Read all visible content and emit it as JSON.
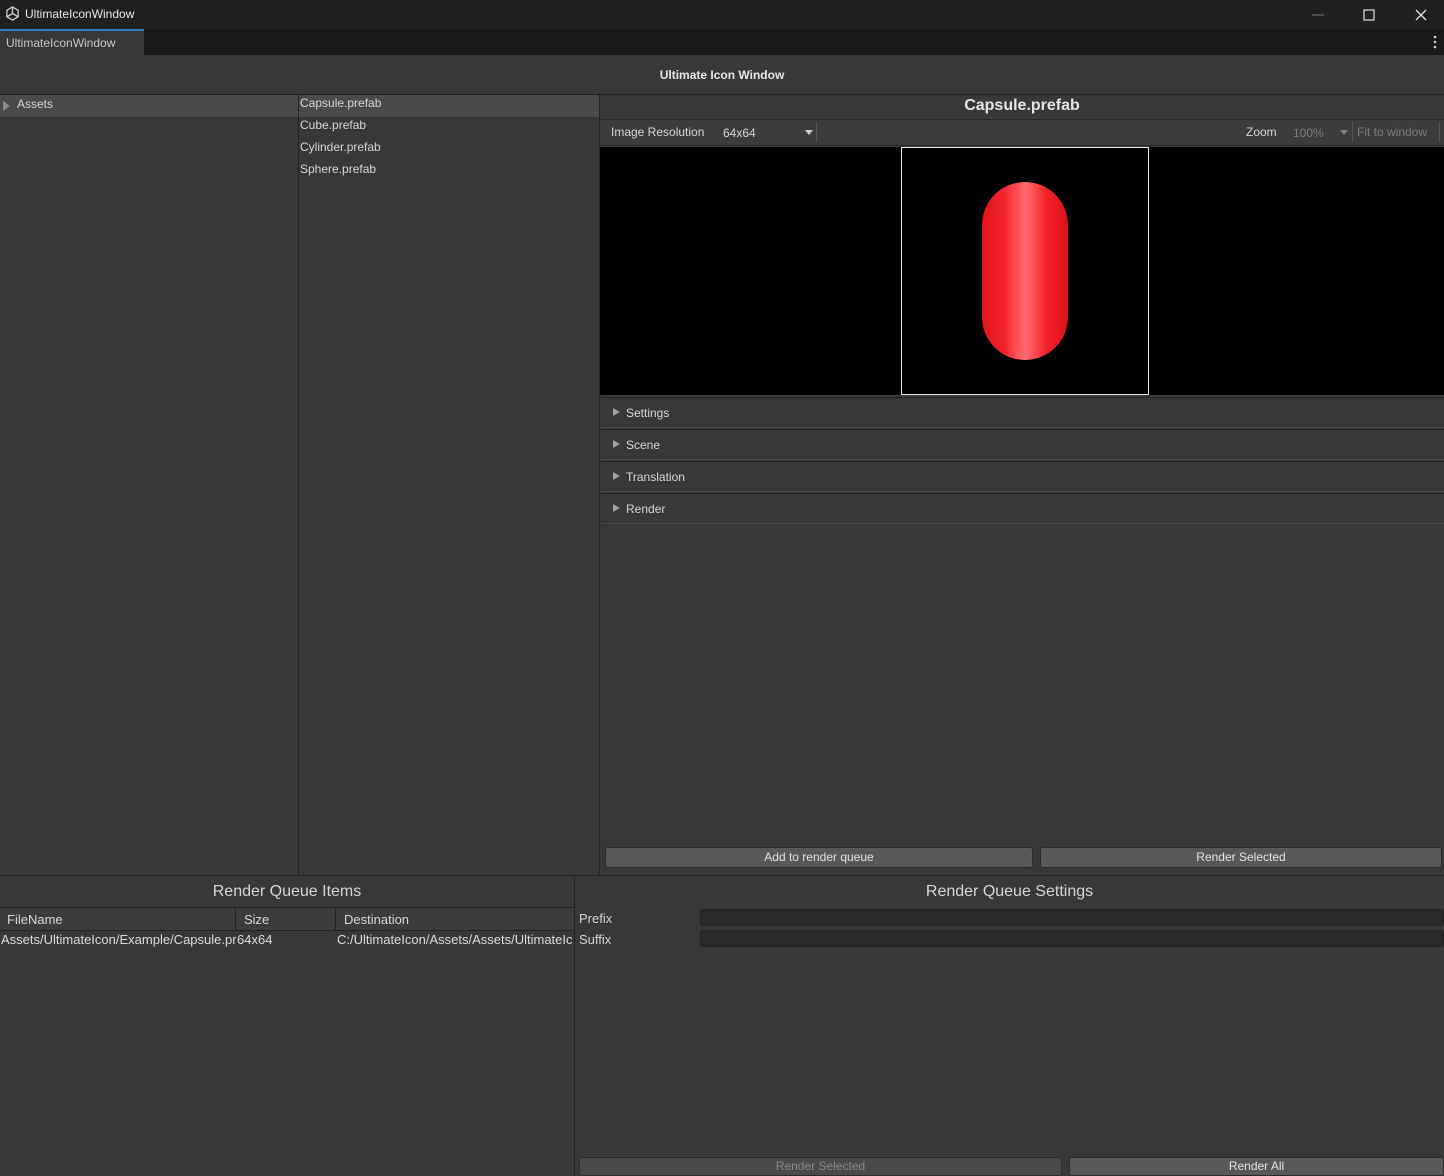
{
  "window": {
    "title": "UltimateIconWindow",
    "tab_label": "UltimateIconWindow",
    "heading": "Ultimate Icon Window"
  },
  "tree": {
    "root_label": "Assets"
  },
  "files": [
    {
      "name": "Capsule.prefab",
      "selected": true
    },
    {
      "name": "Cube.prefab",
      "selected": false
    },
    {
      "name": "Cylinder.prefab",
      "selected": false
    },
    {
      "name": "Sphere.prefab",
      "selected": false
    }
  ],
  "inspector": {
    "asset_title": "Capsule.prefab",
    "resolution_label": "Image Resolution",
    "resolution_value": "64x64",
    "zoom_label": "Zoom",
    "zoom_value": "100%",
    "fit_label": "Fit to window",
    "preview_color": "#f5222a",
    "foldouts": [
      "Settings",
      "Scene",
      "Translation",
      "Render"
    ],
    "add_queue_label": "Add to render queue",
    "render_selected_label": "Render Selected"
  },
  "queue": {
    "title": "Render Queue Items",
    "columns": [
      "FileName",
      "Size",
      "Destination"
    ],
    "rows": [
      {
        "filename": "Assets/UltimateIcon/Example/Capsule.prefab",
        "size": "64x64",
        "destination": "C:/UltimateIcon/Assets/Assets/UltimateIcon"
      }
    ]
  },
  "queue_settings": {
    "title": "Render Queue Settings",
    "prefix_label": "Prefix",
    "prefix_value": "",
    "suffix_label": "Suffix",
    "suffix_value": "",
    "render_selected_label": "Render Selected",
    "render_all_label": "Render All"
  },
  "colors": {
    "tab_accent": "#3a79bb",
    "background": "#383838"
  }
}
